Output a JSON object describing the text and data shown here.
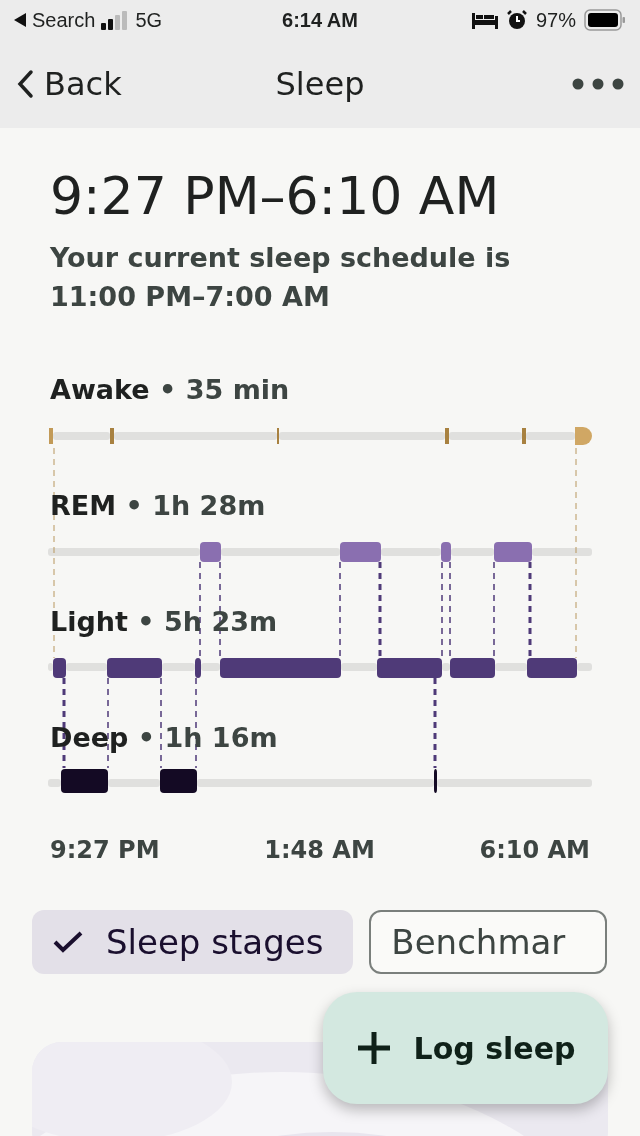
{
  "status_bar": {
    "back_app": "Search",
    "network": "5G",
    "time": "6:14 AM",
    "battery": "97%"
  },
  "nav": {
    "back": "Back",
    "title": "Sleep"
  },
  "summary": {
    "time_range": "9:27 PM–6:10 AM",
    "schedule": "Your current sleep schedule is 11:00 PM–7:00 AM"
  },
  "stages": [
    {
      "name": "Awake",
      "separator": "•",
      "duration": "35 min"
    },
    {
      "name": "REM",
      "separator": "•",
      "duration": "1h 28m"
    },
    {
      "name": "Light",
      "separator": "•",
      "duration": "5h 23m"
    },
    {
      "name": "Deep",
      "separator": "•",
      "duration": "1h 16m"
    }
  ],
  "time_axis": [
    "9:27 PM",
    "1:48 AM",
    "6:10 AM"
  ],
  "chips": [
    {
      "label": "Sleep stages",
      "selected": true
    },
    {
      "label": "Benchmar",
      "selected": false
    }
  ],
  "fab": {
    "label": "Log sleep"
  }
}
